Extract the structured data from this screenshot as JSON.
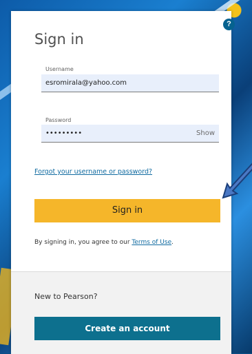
{
  "title": "Sign in",
  "help_icon_symbol": "?",
  "username": {
    "label": "Username",
    "value": "esromirala@yahoo.com"
  },
  "password": {
    "label": "Password",
    "value": "•••••••••",
    "toggle": "Show"
  },
  "forgot_link": "Forgot your username or password?",
  "signin_button": "Sign in",
  "agreement": {
    "prefix": "By signing in, you agree to our ",
    "link": "Terms of Use",
    "suffix": "."
  },
  "new_prompt": "New to Pearson?",
  "create_button": "Create an account",
  "colors": {
    "accent_button": "#f5b62a",
    "create_button": "#0d708e",
    "link": "#0f6aa0",
    "arrow": "#4a78c4"
  },
  "icons": [
    "help-icon",
    "pointer-arrow-icon"
  ]
}
